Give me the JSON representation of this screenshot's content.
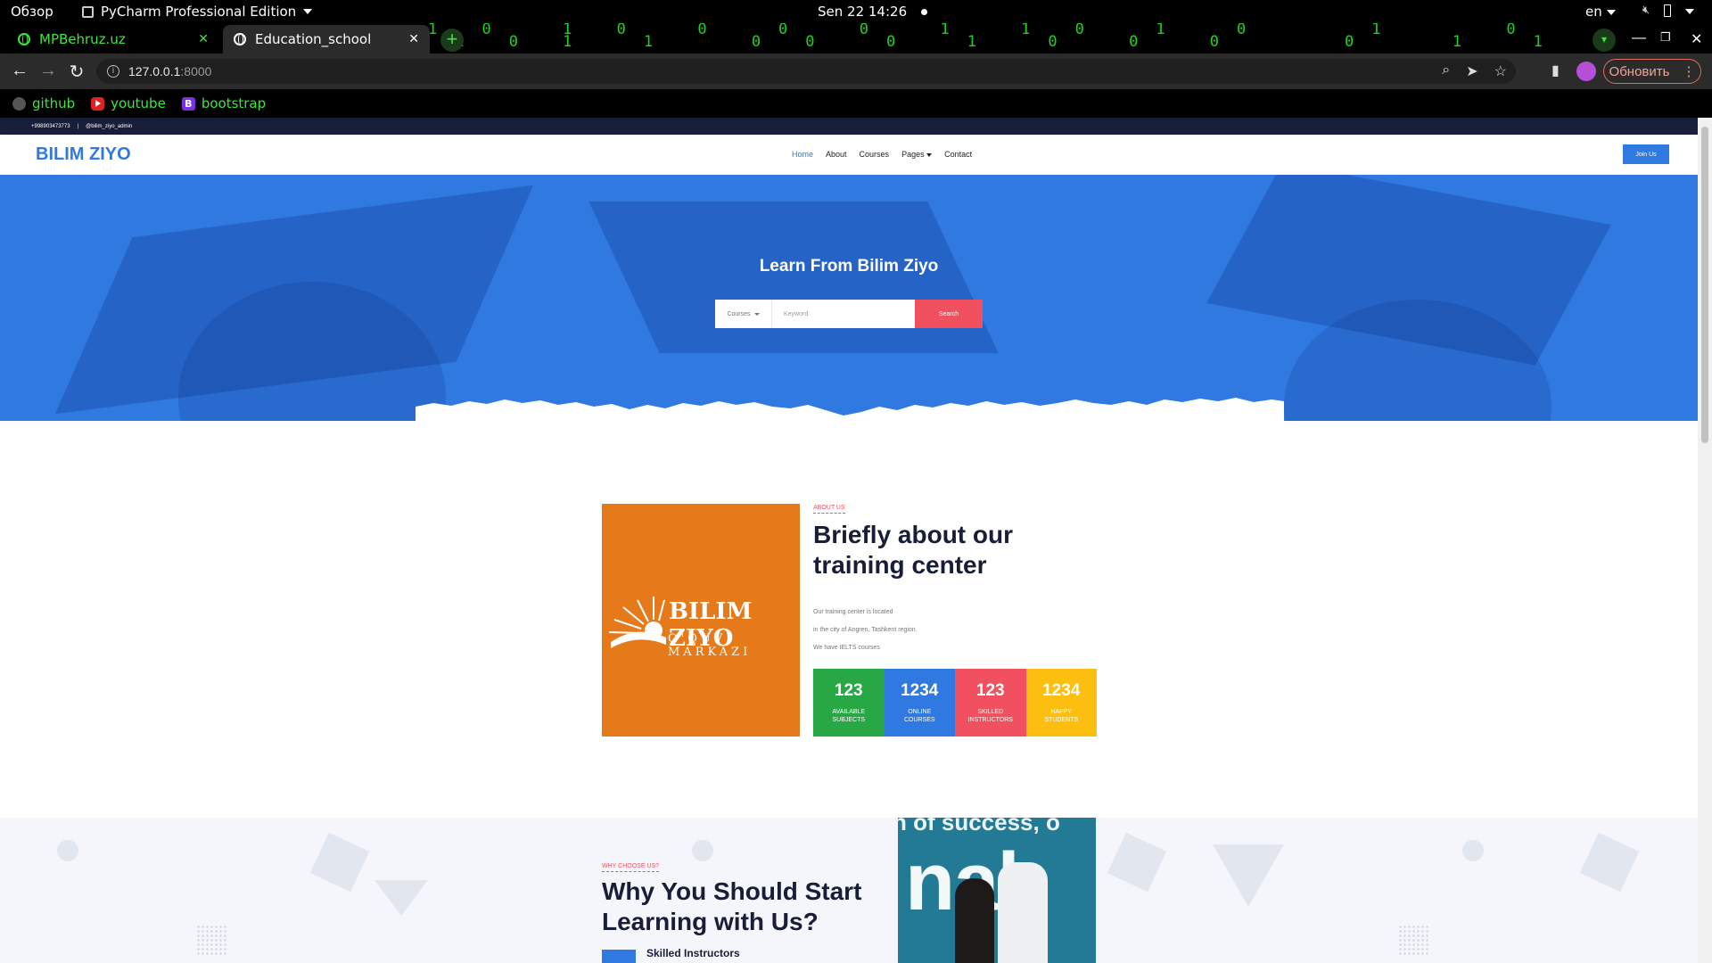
{
  "os": {
    "activities": "Обзор",
    "app_name": "PyCharm Professional Edition",
    "clock": "Sen 22  14:26",
    "lang": "en"
  },
  "browser": {
    "tabs": [
      {
        "title": "MPBehruz.uz"
      },
      {
        "title": "Education_school"
      }
    ],
    "url_host": "127.0.0.1",
    "url_port": ":8000",
    "update_label": "Обновить",
    "bookmarks": [
      {
        "label": "github",
        "icon": "github-icon"
      },
      {
        "label": "youtube",
        "icon": "youtube-icon"
      },
      {
        "label": "bootstrap",
        "icon": "bootstrap-icon"
      }
    ],
    "matrix_rain": "1 0  1 0  0  0  0  1  1 0  1  0    1    0  1  0 1  1 0  1  0\n 1 0 1  1   0 0  0  1  0  0  0    0   1  1   1 0 0 1  0  1"
  },
  "site": {
    "topbar": {
      "phone": "+998903473773",
      "sep": "|",
      "telegram": "@bilim_ziyo_admin"
    },
    "brand": "BILIM ZIYO",
    "nav": [
      {
        "label": "Home",
        "active": true
      },
      {
        "label": "About"
      },
      {
        "label": "Courses"
      },
      {
        "label": "Pages"
      },
      {
        "label": "Contact"
      }
    ],
    "join_label": "Join Us",
    "hero": {
      "title": "Learn From Bilim Ziyo",
      "select_label": "Courses",
      "search_placeholder": "Keyword",
      "search_button": "Search"
    },
    "about": {
      "logo_main": "BILIM ZIYO",
      "logo_sub": "O'QUV MARKAZI",
      "kicker": "ABOUT US",
      "heading": "Briefly about our training center",
      "paragraphs": [
        "Our training center is located",
        "in the city of Angren, Tashkent region.",
        "We have IELTS courses"
      ],
      "stats": [
        {
          "number": "123",
          "label": "AVAILABLE SUBJECTS",
          "color": "#27a844"
        },
        {
          "number": "1234",
          "label": "ONLINE COURSES",
          "color": "#2f79e0"
        },
        {
          "number": "123",
          "label": "SKILLED INSTRUCTORS",
          "color": "#f1505e"
        },
        {
          "number": "1234",
          "label": "HAPPY STUDENTS",
          "color": "#fcbf0f"
        }
      ]
    },
    "why": {
      "kicker": "WHY CHOOSE US?",
      "heading": "Why You Should Start Learning with Us?",
      "feature_title": "Skilled Instructors",
      "image_text_top": "n of success, o",
      "image_text_big": "nak"
    }
  },
  "colors": {
    "primary": "#2f79e0",
    "accent": "#f1505e",
    "dark": "#181d38",
    "matrix_green": "#3ce63c"
  }
}
